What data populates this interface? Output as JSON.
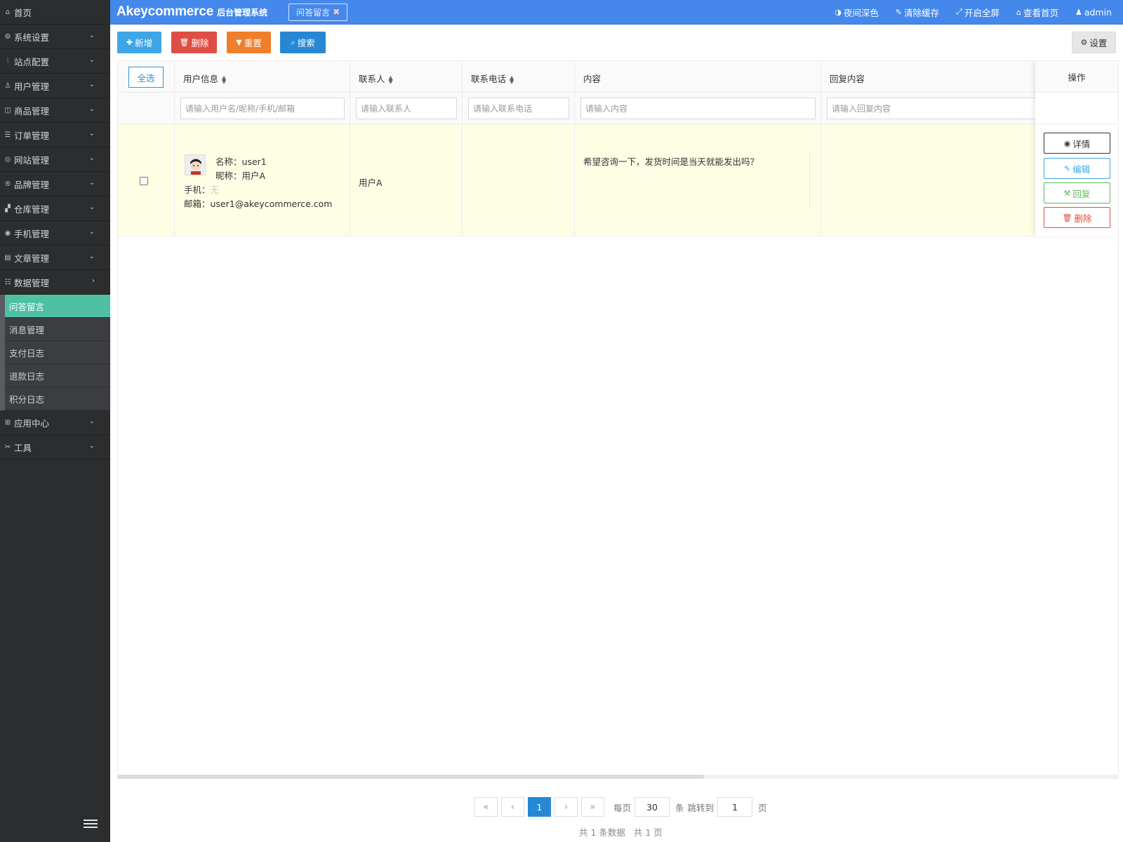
{
  "sidebar": {
    "home": "首页",
    "items": [
      {
        "label": "系统设置",
        "icon": "gear-icon"
      },
      {
        "label": "站点配置",
        "icon": "sliders-icon"
      },
      {
        "label": "用户管理",
        "icon": "user-icon"
      },
      {
        "label": "商品管理",
        "icon": "bag-icon"
      },
      {
        "label": "订单管理",
        "icon": "list-icon"
      },
      {
        "label": "网站管理",
        "icon": "globe-icon"
      },
      {
        "label": "品牌管理",
        "icon": "registered-icon"
      },
      {
        "label": "仓库管理",
        "icon": "boxes-icon"
      },
      {
        "label": "手机管理",
        "icon": "phone-icon"
      },
      {
        "label": "文章管理",
        "icon": "document-icon"
      },
      {
        "label": "数据管理",
        "icon": "database-icon"
      }
    ],
    "sub_items": [
      "问答留言",
      "消息管理",
      "支付日志",
      "退款日志",
      "积分日志"
    ],
    "bottom_items": [
      {
        "label": "应用中心",
        "icon": "grid-icon"
      },
      {
        "label": "工具",
        "icon": "tools-icon"
      }
    ]
  },
  "topbar": {
    "brand": "Akeycommerce",
    "brand_sub": "后台管理系统",
    "open_tab": "问答留言",
    "links": [
      "夜间深色",
      "清除缓存",
      "开启全屏",
      "查看首页",
      "admin"
    ]
  },
  "toolbar": {
    "add": "新增",
    "delete": "删除",
    "reset": "重置",
    "search": "搜索",
    "settings": "设置"
  },
  "table": {
    "select_all": "全选",
    "columns": [
      "用户信息",
      "联系人",
      "联系电话",
      "内容",
      "回复内容",
      "操作"
    ],
    "placeholders": [
      "请输入用户名/昵称/手机/邮箱",
      "请输入联系人",
      "请输入联系电话",
      "请输入内容",
      "请输入回复内容"
    ],
    "rows": [
      {
        "name_label": "名称：",
        "name": "user1",
        "nick_label": "昵称：",
        "nick": "用户A",
        "phone_label": "手机：",
        "phone": "无",
        "email_label": "邮箱：",
        "email": "user1@akeycommerce.com",
        "contact": "用户A",
        "contact_phone": "",
        "content": "希望咨询一下，发货时间是当天就能发出吗？",
        "reply": ""
      }
    ],
    "actions": {
      "detail": "详情",
      "edit": "编辑",
      "reply": "回复",
      "delete": "删除"
    }
  },
  "pagination": {
    "first": "«",
    "prev": "‹",
    "current": "1",
    "next": "›",
    "last": "»",
    "per_page_label": "每页",
    "per_page": "30",
    "per_page_unit": "条",
    "jump_label": "跳转到",
    "jump_page": "1",
    "page_unit": "页",
    "total_records": "共 1 条数据",
    "total_pages": "共 1 页"
  },
  "colors": {
    "topbar": "#4488ec",
    "sidebar": "#2b2d2f",
    "active_menu": "#4fc1a2",
    "row_highlight": "#fefee5"
  }
}
